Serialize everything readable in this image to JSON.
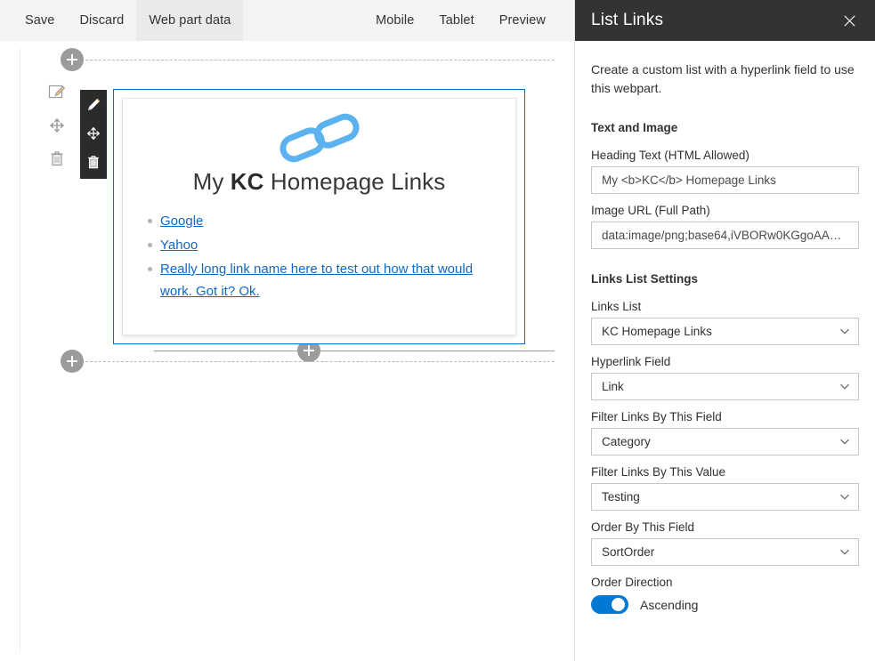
{
  "commandbar": {
    "left_items": [
      {
        "label": "Save",
        "active": false
      },
      {
        "label": "Discard",
        "active": false
      },
      {
        "label": "Web part data",
        "active": true
      }
    ],
    "right_items": [
      {
        "label": "Mobile"
      },
      {
        "label": "Tablet"
      },
      {
        "label": "Preview"
      }
    ]
  },
  "canvas": {
    "webpart_toolbar": {
      "edit_tooltip": "Edit web part",
      "move_tooltip": "Move web part",
      "delete_tooltip": "Delete web part"
    },
    "section_toolbar": {
      "edit_tooltip": "Edit section",
      "move_tooltip": "Move section",
      "delete_tooltip": "Delete section"
    },
    "add_buttons": {
      "top_label": "+",
      "bottom_center_label": "+",
      "bottom_left_label": "+"
    },
    "webpart": {
      "title_prefix": "My ",
      "title_bold": "KC",
      "title_suffix": " Homepage Links",
      "logo_name": "chain-link-icon",
      "logo_color": "#5cb2ef",
      "links": [
        {
          "label": "Google"
        },
        {
          "label": "Yahoo"
        },
        {
          "label": "Really long link name here to test out how that would work. Got it? Ok."
        }
      ],
      "link_color": "#1268c3"
    }
  },
  "panel": {
    "title": "List Links",
    "close_label": "✕",
    "description": "Create a custom list with a hyperlink field to use this webpart.",
    "sections": [
      {
        "heading": "Text and Image",
        "fields": [
          {
            "label": "Heading Text (HTML Allowed)",
            "type": "textbox",
            "value": "My <b>KC</b> Homepage Links"
          },
          {
            "label": "Image URL (Full Path)",
            "type": "textbox",
            "value": "data:image/png;base64,iVBORw0KGgoAA…"
          }
        ]
      },
      {
        "heading": "Links List Settings",
        "fields": [
          {
            "label": "Links List",
            "type": "dropdown",
            "value": "KC Homepage Links"
          },
          {
            "label": "Hyperlink Field",
            "type": "dropdown",
            "value": "Link"
          },
          {
            "label": "Filter Links By This Field",
            "type": "dropdown",
            "value": "Category"
          },
          {
            "label": "Filter Links By This Value",
            "type": "dropdown",
            "value": "Testing"
          },
          {
            "label": "Order By This Field",
            "type": "dropdown",
            "value": "SortOrder"
          }
        ],
        "toggle": {
          "label": "Order Direction",
          "state_label": "Ascending",
          "on": true,
          "accent": "#0078d4"
        }
      }
    ]
  }
}
